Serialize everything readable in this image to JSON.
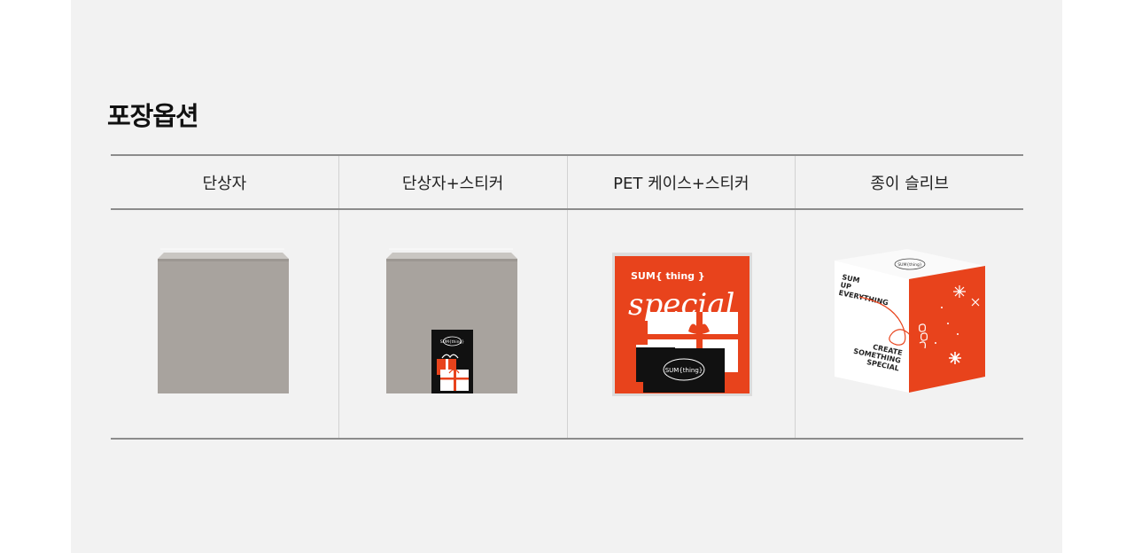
{
  "page": {
    "title": "포장옵션"
  },
  "options": [
    {
      "label": "단상자"
    },
    {
      "label": "단상자+스티커"
    },
    {
      "label": "PET 케이스+스티커"
    },
    {
      "label": "종이 슬리브"
    }
  ],
  "products": {
    "sticker_logo": "SUM{thing}",
    "pet_brand": "SUM{ thing }",
    "pet_script": "special",
    "sleeve_logo": "SUM{thing}",
    "sleeve_text_top": [
      "SUM",
      "UP",
      "EVERYTHING"
    ],
    "sleeve_text_bottom": [
      "CREATE",
      "SOMETHING",
      "SPECIAL"
    ]
  },
  "colors": {
    "panel_bg": "#f2f2f2",
    "kraft": "#a8a39e",
    "brand_orange": "#e8431c",
    "black": "#111111"
  }
}
